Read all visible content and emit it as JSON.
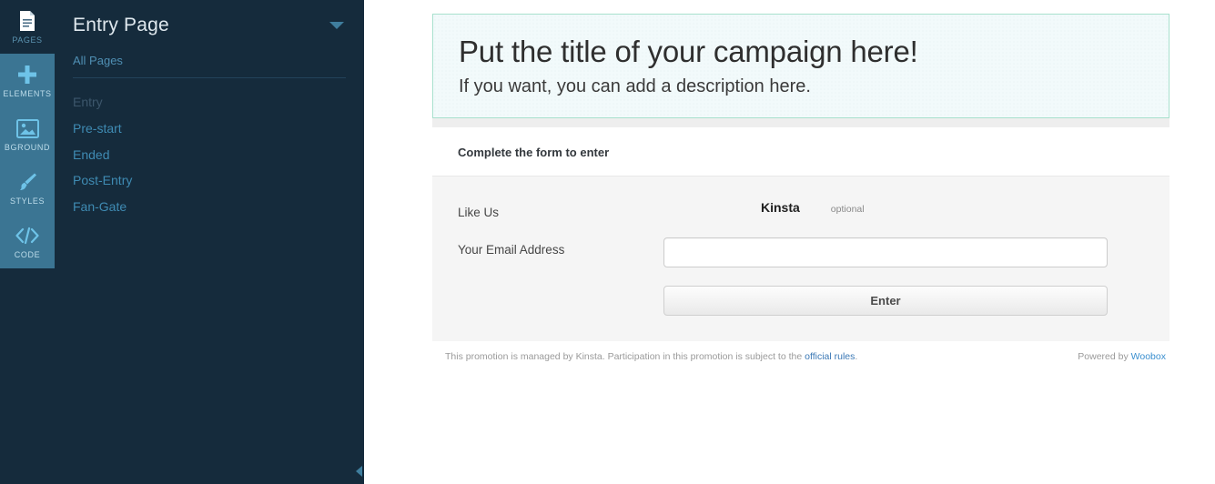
{
  "rail": {
    "items": [
      {
        "label": "PAGES",
        "icon": "document-icon",
        "state": "dark"
      },
      {
        "label": "ELEMENTS",
        "icon": "plus-icon",
        "state": "shaded"
      },
      {
        "label": "BGROUND",
        "icon": "image-icon",
        "state": "shaded"
      },
      {
        "label": "STYLES",
        "icon": "brush-icon",
        "state": "shaded"
      },
      {
        "label": "CODE",
        "icon": "code-icon",
        "state": "shaded"
      }
    ]
  },
  "sidebar": {
    "title": "Entry Page",
    "caret_icon": "chevron-down-icon",
    "all_pages_label": "All Pages",
    "collapse_icon": "chevron-left-icon",
    "items": [
      {
        "label": "Entry",
        "state": "current"
      },
      {
        "label": "Pre-start",
        "state": "link"
      },
      {
        "label": "Ended",
        "state": "link"
      },
      {
        "label": "Post-Entry",
        "state": "link"
      },
      {
        "label": "Fan-Gate",
        "state": "link"
      }
    ]
  },
  "preview": {
    "hero": {
      "title": "Put the title of your campaign here!",
      "description": "If you want, you can add a description here.",
      "border_color": "#a8e0cd",
      "background_color": "#f2fafb"
    },
    "section_label": "Complete the form to enter",
    "form": {
      "rows": [
        {
          "label": "Like Us",
          "type": "like",
          "brand": "Kinsta",
          "optional_label": "optional"
        },
        {
          "label": "Your Email Address",
          "type": "input",
          "value": "",
          "placeholder": ""
        }
      ],
      "submit_label": "Enter"
    },
    "legal": {
      "text_before": "This promotion is managed by Kinsta. Participation in this promotion is subject to the ",
      "link_label": "official rules",
      "text_after": ".",
      "powered_prefix": "Powered by ",
      "powered_brand": "Woobox"
    }
  }
}
